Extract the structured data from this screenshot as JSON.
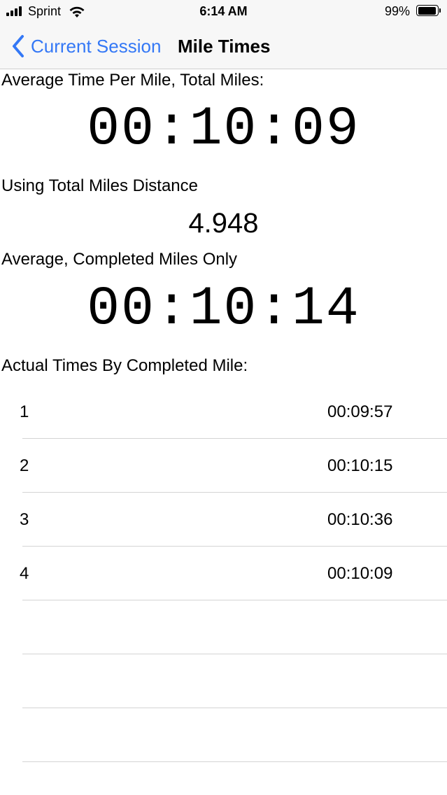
{
  "status_bar": {
    "carrier": "Sprint",
    "time": "6:14 AM",
    "battery_percent": "99%",
    "battery_level": 0.99
  },
  "nav": {
    "back_label": "Current Session",
    "title": "Mile Times"
  },
  "main": {
    "avg_total_label": "Average Time Per Mile, Total Miles:",
    "avg_total_value": "00:10:09",
    "distance_label": "Using Total Miles Distance",
    "distance_value": "4.948",
    "avg_completed_label": "Average, Completed Miles Only",
    "avg_completed_value": "00:10:14",
    "list_label": "Actual Times By Completed Mile:"
  },
  "miles": [
    {
      "number": "1",
      "time": "00:09:57"
    },
    {
      "number": "2",
      "time": "00:10:15"
    },
    {
      "number": "3",
      "time": "00:10:36"
    },
    {
      "number": "4",
      "time": "00:10:09"
    },
    {
      "number": "",
      "time": ""
    },
    {
      "number": "",
      "time": ""
    },
    {
      "number": "",
      "time": ""
    }
  ],
  "colors": {
    "accent": "#3478f6",
    "bar_background": "#f7f7f7",
    "divider": "#d4d4d4"
  },
  "icons": {
    "signal": "cellular-signal-icon",
    "wifi": "wifi-icon",
    "battery": "battery-icon",
    "back": "chevron-left-icon"
  }
}
